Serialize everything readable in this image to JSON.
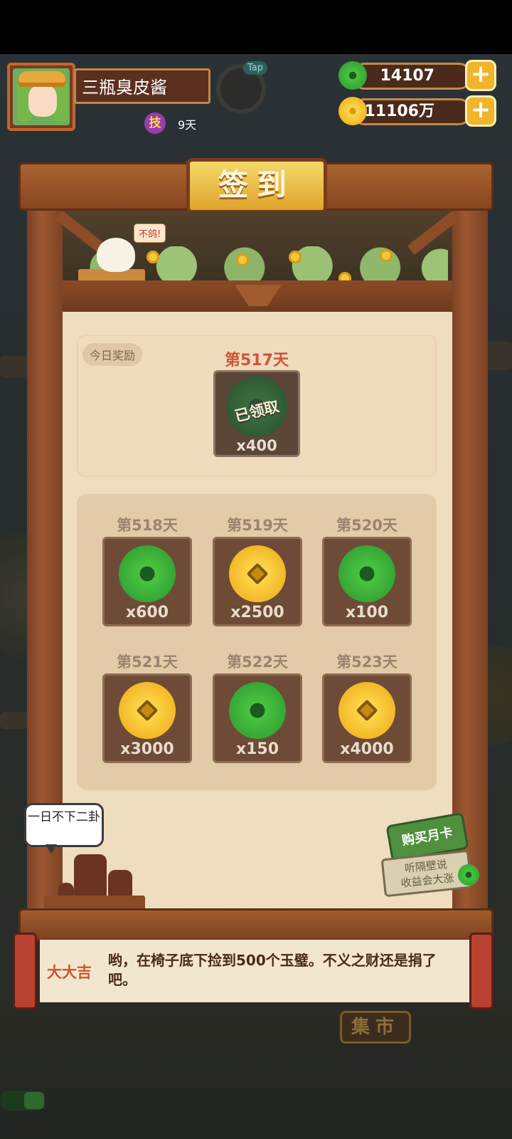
{
  "header": {
    "player_name": "三瓶臭皮酱",
    "skill_badge": "技",
    "skill_days": "9天",
    "tap_label": "Tap"
  },
  "resources": {
    "jade": {
      "icon": "jade-icon",
      "value": "14107",
      "plus_label": "+"
    },
    "coins": {
      "icon": "coin-icon",
      "value": "11106万",
      "plus_label": "+"
    }
  },
  "signin": {
    "title": "签到",
    "scene_bubble": "不鸽!",
    "today": {
      "tag": "今日奖励",
      "day_label": "第517天",
      "reward_icon": "jade-icon",
      "status": "已领取",
      "quantity": "x400"
    },
    "upcoming": [
      {
        "day_label": "第518天",
        "reward_icon": "jade-icon",
        "quantity": "x600"
      },
      {
        "day_label": "第519天",
        "reward_icon": "coin-icon",
        "quantity": "x2500"
      },
      {
        "day_label": "第520天",
        "reward_icon": "jade-icon",
        "quantity": "x100"
      },
      {
        "day_label": "第521天",
        "reward_icon": "coin-icon",
        "quantity": "x3000"
      },
      {
        "day_label": "第522天",
        "reward_icon": "jade-icon",
        "quantity": "x150"
      },
      {
        "day_label": "第523天",
        "reward_icon": "coin-icon",
        "quantity": "x4000"
      }
    ]
  },
  "decor": {
    "speech_bubble": "一日不下二卦",
    "month_card": {
      "button_label": "购买月卡",
      "board_text_1": "听隔壁说",
      "board_text_2": "收益会大涨"
    }
  },
  "fortune": {
    "label": "大大吉",
    "message": "哟，在椅子底下捡到500个玉璧。不义之财还是捐了吧。"
  },
  "market": {
    "label": "集市"
  },
  "colors": {
    "accent_red": "#c9573a",
    "frame_wood": "#9c5831",
    "jade_green": "#3fb23a",
    "coin_gold": "#f2b829"
  }
}
